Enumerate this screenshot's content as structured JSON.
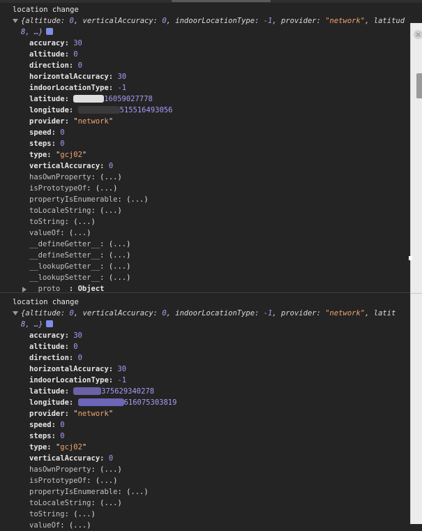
{
  "logs": [
    {
      "title": "location change",
      "summary_line1": {
        "prefix": "{altitude: ",
        "altitude": "0",
        "mid1": ", verticalAccuracy: ",
        "vertical": "0",
        "mid2": ", indoorLocationType: ",
        "indoor": "-1",
        "mid3": ", provider: ",
        "provider": "\"network\"",
        "suffix": ", latitud"
      },
      "summary_line2": "8, …}",
      "props": {
        "accuracy": {
          "key": "accuracy",
          "value": "30"
        },
        "altitude": {
          "key": "altitude",
          "value": "0"
        },
        "direction": {
          "key": "direction",
          "value": "0"
        },
        "horizontalAccuracy": {
          "key": "horizontalAccuracy",
          "value": "30"
        },
        "indoorLocationType": {
          "key": "indoorLocationType",
          "value": "-1"
        },
        "latitude": {
          "key": "latitude",
          "value": "16059027778"
        },
        "longitude": {
          "key": "longitude",
          "value": "515516493056"
        },
        "provider": {
          "key": "provider",
          "value": "network"
        },
        "speed": {
          "key": "speed",
          "value": "0"
        },
        "steps": {
          "key": "steps",
          "value": "0"
        },
        "type": {
          "key": "type",
          "value": "gcj02"
        },
        "verticalAccuracy": {
          "key": "verticalAccuracy",
          "value": "0"
        }
      },
      "methods": [
        {
          "key": "hasOwnProperty",
          "value": "(...)"
        },
        {
          "key": "isPrototypeOf",
          "value": "(...)"
        },
        {
          "key": "propertyIsEnumerable",
          "value": "(...)"
        },
        {
          "key": "toLocaleString",
          "value": "(...)"
        },
        {
          "key": "toString",
          "value": "(...)"
        },
        {
          "key": "valueOf",
          "value": "(...)"
        },
        {
          "key": "__defineGetter__",
          "value": "(...)"
        },
        {
          "key": "__defineSetter__",
          "value": "(...)"
        },
        {
          "key": "__lookupGetter__",
          "value": "(...)"
        },
        {
          "key": "__lookupSetter__",
          "value": "(...)"
        }
      ],
      "proto": {
        "key": "__proto__",
        "value": "Object"
      }
    },
    {
      "title": "location change",
      "summary_line1": {
        "prefix": "{altitude: ",
        "altitude": "0",
        "mid1": ", verticalAccuracy: ",
        "vertical": "0",
        "mid2": ", indoorLocationType: ",
        "indoor": "-1",
        "mid3": ", provider: ",
        "provider": "\"network\"",
        "suffix": ", latit"
      },
      "summary_line2": "8, …}",
      "props": {
        "accuracy": {
          "key": "accuracy",
          "value": "30"
        },
        "altitude": {
          "key": "altitude",
          "value": "0"
        },
        "direction": {
          "key": "direction",
          "value": "0"
        },
        "horizontalAccuracy": {
          "key": "horizontalAccuracy",
          "value": "30"
        },
        "indoorLocationType": {
          "key": "indoorLocationType",
          "value": "-1"
        },
        "latitude": {
          "key": "latitude",
          "value": "375629340278"
        },
        "longitude": {
          "key": "longitude",
          "value": "616075303819"
        },
        "provider": {
          "key": "provider",
          "value": "network"
        },
        "speed": {
          "key": "speed",
          "value": "0"
        },
        "steps": {
          "key": "steps",
          "value": "0"
        },
        "type": {
          "key": "type",
          "value": "gcj02"
        },
        "verticalAccuracy": {
          "key": "verticalAccuracy",
          "value": "0"
        }
      },
      "methods": [
        {
          "key": "hasOwnProperty",
          "value": "(...)"
        },
        {
          "key": "isPrototypeOf",
          "value": "(...)"
        },
        {
          "key": "propertyIsEnumerable",
          "value": "(...)"
        },
        {
          "key": "toLocaleString",
          "value": "(...)"
        },
        {
          "key": "toString",
          "value": "(...)"
        },
        {
          "key": "valueOf",
          "value": "(...)"
        }
      ]
    }
  ],
  "side_panel": {
    "close_glyph": "×"
  },
  "colors": {
    "number": "#a79cf5",
    "string": "#f3a36b",
    "background": "#242424"
  }
}
